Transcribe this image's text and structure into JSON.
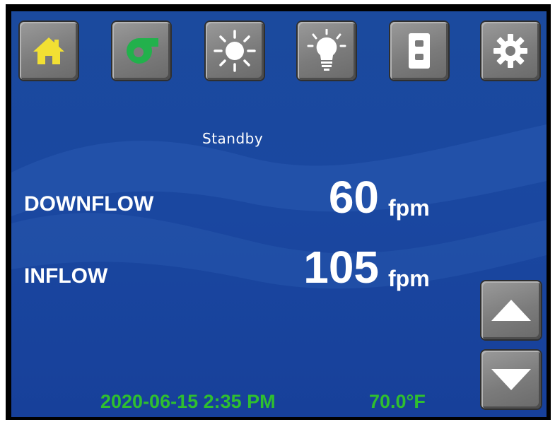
{
  "toolbar": {
    "buttons": [
      {
        "name": "home",
        "icon": "home-icon",
        "icon_color": "#f2e033"
      },
      {
        "name": "blower",
        "icon": "fan-blower-icon",
        "icon_color": "#22b14c"
      },
      {
        "name": "uv-light",
        "icon": "sun-icon",
        "icon_color": "#ffffff"
      },
      {
        "name": "light",
        "icon": "lightbulb-icon",
        "icon_color": "#ffffff"
      },
      {
        "name": "outlet",
        "icon": "outlet-icon",
        "icon_color": "#ffffff"
      },
      {
        "name": "settings",
        "icon": "gear-icon",
        "icon_color": "#ffffff"
      }
    ]
  },
  "status": {
    "mode": "Standby"
  },
  "readings": {
    "downflow": {
      "label": "DOWNFLOW",
      "value": "60",
      "unit": "fpm"
    },
    "inflow": {
      "label": "INFLOW",
      "value": "105",
      "unit": "fpm"
    }
  },
  "footer": {
    "datetime": "2020-06-15 2:35 PM",
    "temperature": "70.0°F",
    "text_color": "#2fbf2f"
  },
  "nav": {
    "up_icon": "arrow-up-icon",
    "down_icon": "arrow-down-icon"
  },
  "colors": {
    "screen_background": "#1a47a0",
    "button_gray": "#808080"
  }
}
